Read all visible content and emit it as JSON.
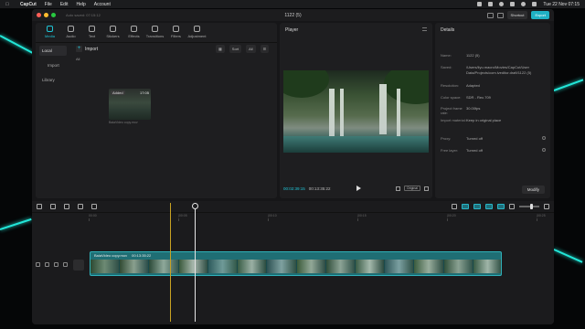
{
  "menubar": {
    "items": [
      "CapCut",
      "File",
      "Edit",
      "Help",
      "Account"
    ],
    "clock": "Tue 22 Nov  07:15"
  },
  "window": {
    "autosave": "Auto saved: 07:15:12",
    "title": "1122 (5)",
    "shortcut_label": "Shortcut",
    "export_label": "Export"
  },
  "media": {
    "tabs": [
      "Media",
      "Audio",
      "Text",
      "Stickers",
      "Effects",
      "Transitions",
      "Filters",
      "Adjustment"
    ],
    "side": [
      "Local",
      "Import",
      "Library"
    ],
    "import_label": "Import",
    "sort_label": "Sort",
    "all_btn": "All",
    "all_label": "All",
    "thumb_badge": "Added",
    "thumb_duration": "17:05",
    "thumb_name": "BaiaVideo copy.mov"
  },
  "player": {
    "title": "Player",
    "current": "00:02:39:15",
    "total": "00:13:35:22",
    "original_label": "Original"
  },
  "details": {
    "title": "Details",
    "rows": [
      {
        "k": "Name:",
        "v": "1122 (5)"
      },
      {
        "k": "Saved:",
        "v": "/Users/liyu.macro/Movies/CapCut/User Data/Projects/com.lveditor.draft/1122 (5)"
      },
      {
        "k": "Resolution:",
        "v": "Adapted"
      },
      {
        "k": "Color space:",
        "v": "SDR - Rec.709"
      },
      {
        "k": "Project frame rate:",
        "v": "30.00fps"
      },
      {
        "k": "Import material:",
        "v": "Keep in original place"
      },
      {
        "k": "Proxy:",
        "v": "Turned off"
      },
      {
        "k": "Free layer:",
        "v": "Turned off"
      }
    ],
    "modify_label": "Modify"
  },
  "timeline": {
    "ticks": [
      "00:00",
      "|00:05",
      "|00:10",
      "|00:15",
      "|00:20",
      "|00:25"
    ],
    "clip_name": "BaiaVideo copy.mov",
    "clip_duration": "00:13:35:22"
  }
}
